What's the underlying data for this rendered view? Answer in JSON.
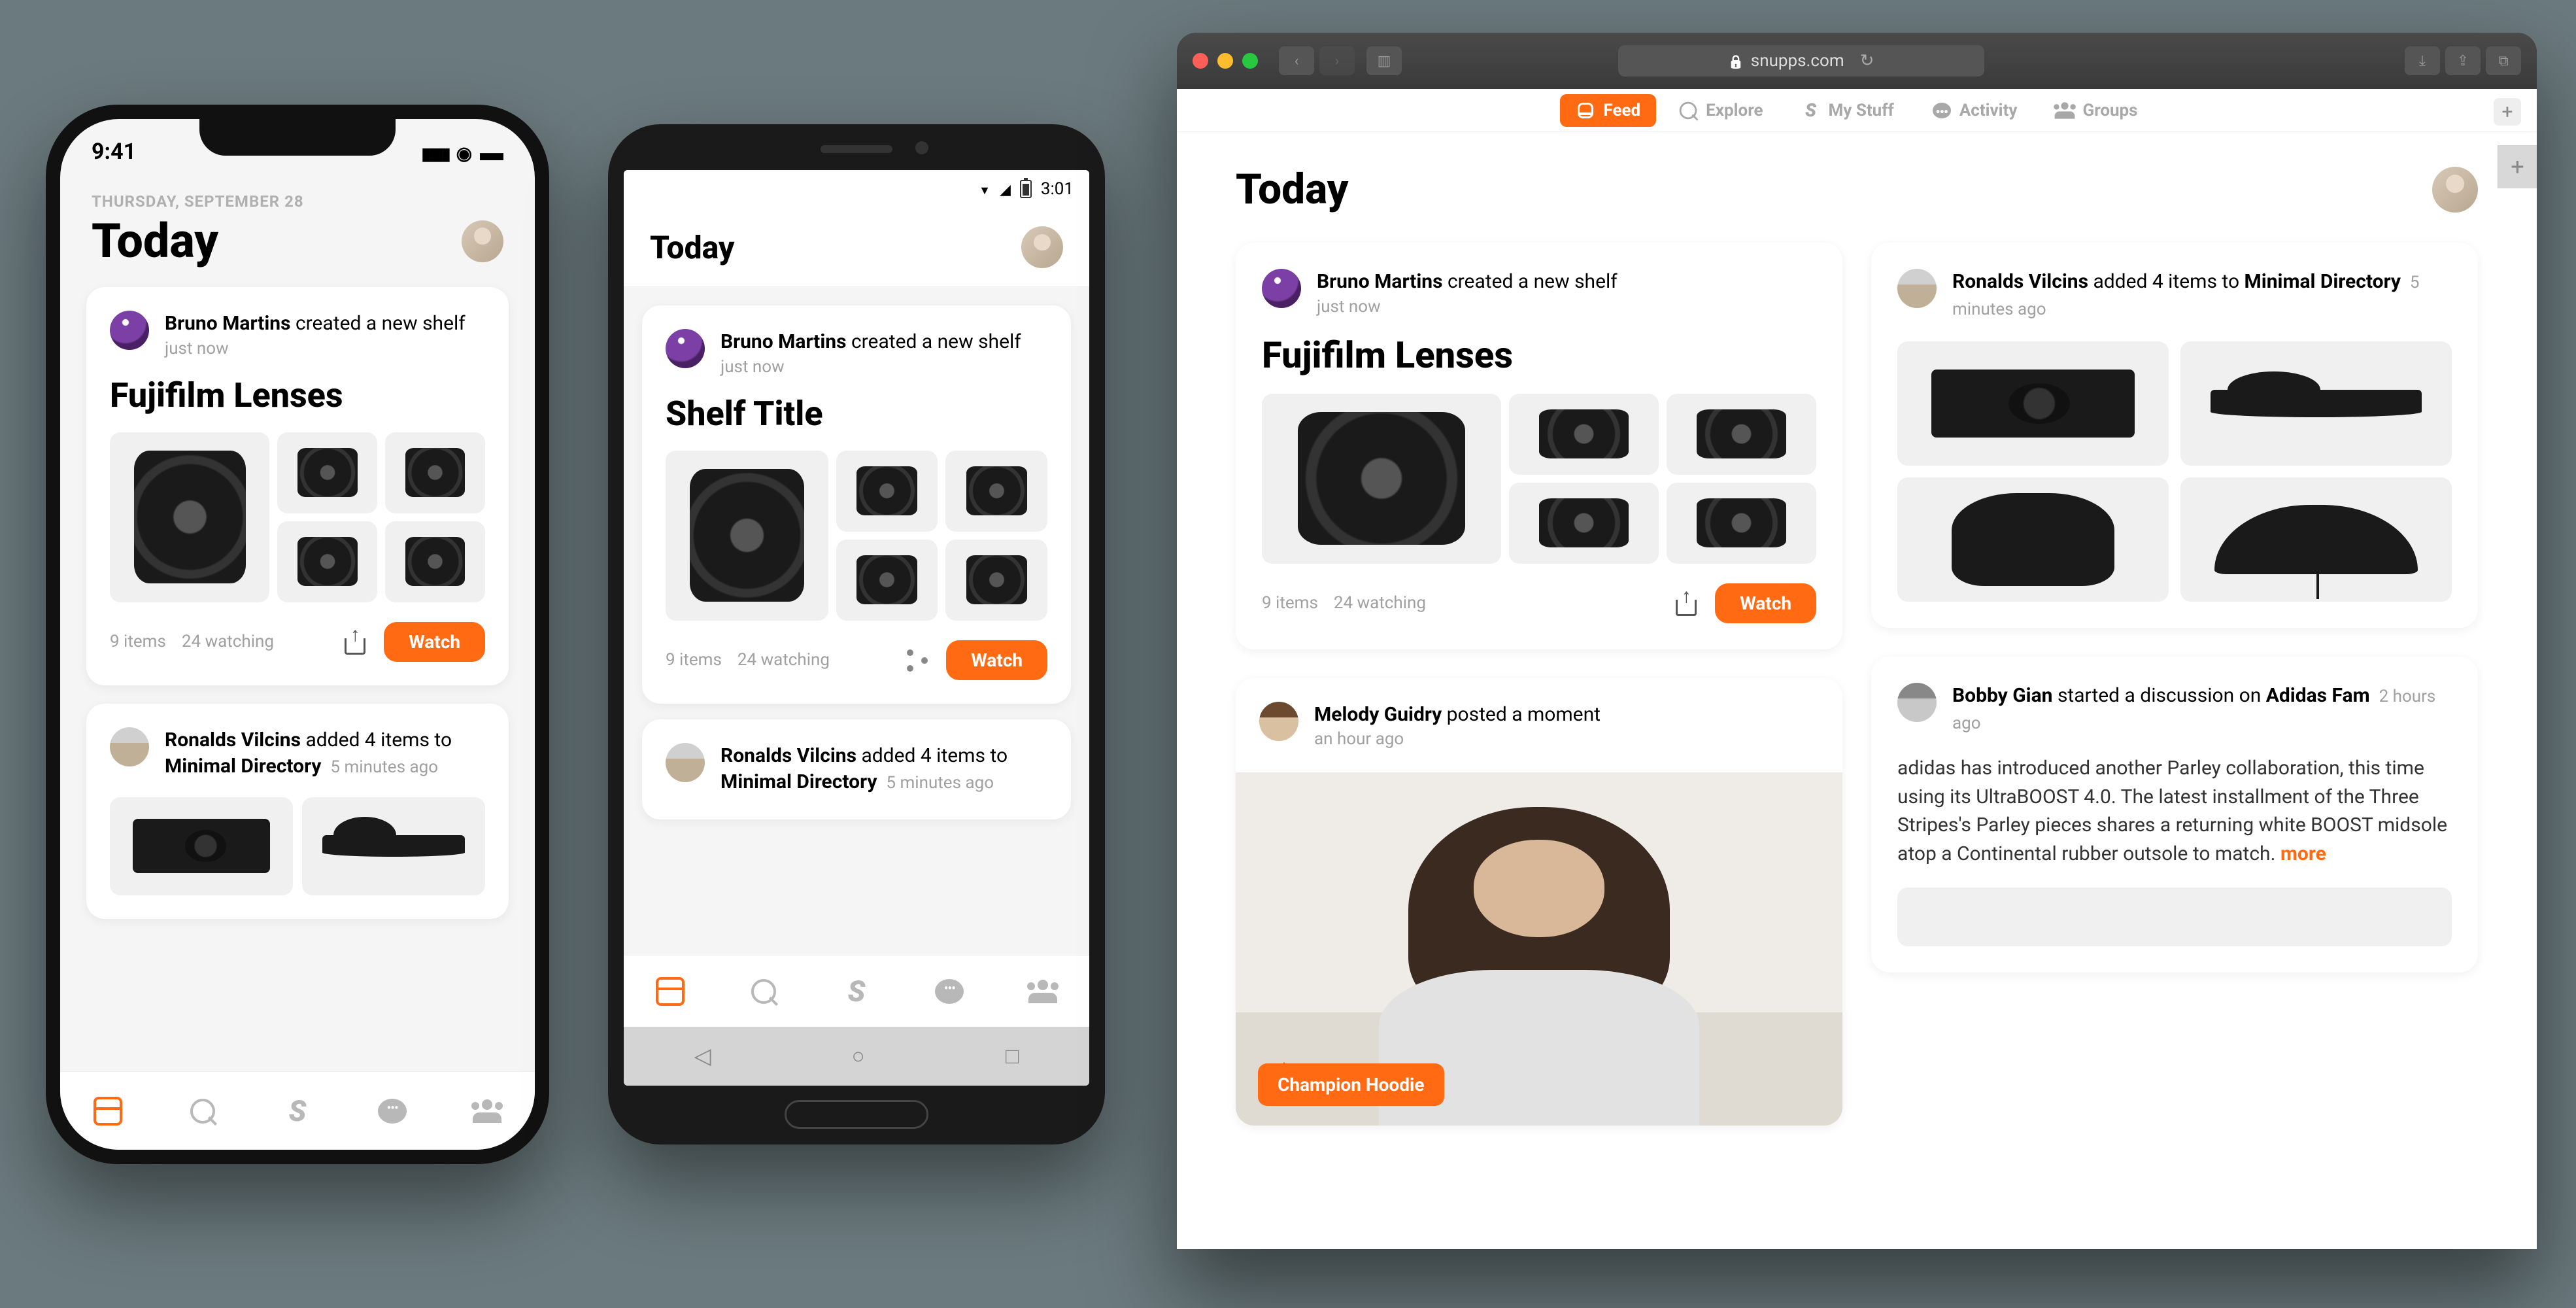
{
  "colors": {
    "accent": "#ff6a13"
  },
  "iphone": {
    "status_time": "9:41",
    "date": "THURSDAY, SEPTEMBER 28",
    "title": "Today",
    "card1": {
      "author": "Bruno Martins",
      "action": " created a new shelf",
      "time": "just now",
      "shelf_title": "Fujifilm Lenses",
      "items_count": "9 items",
      "watching": "24 watching",
      "watch_label": "Watch"
    },
    "card2": {
      "author": "Ronalds Vilcins",
      "action": " added 4 items to ",
      "link": "Minimal Directory",
      "time": "5 minutes ago"
    }
  },
  "android": {
    "status_time": "3:01",
    "title": "Today",
    "card1": {
      "author": "Bruno Martins",
      "action": " created a new shelf",
      "time": "just now",
      "shelf_title": "Shelf Title",
      "items_count": "9 items",
      "watching": "24 watching",
      "watch_label": "Watch"
    },
    "card2": {
      "author": "Ronalds Vilcins",
      "action": " added 4 items to ",
      "link": "Minimal Directory",
      "time": "5 minutes ago"
    }
  },
  "web": {
    "url": "snupps.com",
    "nav": {
      "feed": "Feed",
      "explore": "Explore",
      "mystuff": "My Stuff",
      "activity": "Activity",
      "groups": "Groups"
    },
    "title": "Today",
    "card_shelf": {
      "author": "Bruno Martins",
      "action": " created a new shelf",
      "time": "just now",
      "shelf_title": "Fujifilm Lenses",
      "items_count": "9 items",
      "watching": "24 watching",
      "watch_label": "Watch"
    },
    "card_items": {
      "author": "Ronalds Vilcins",
      "action": " added 4 items to ",
      "link": "Minimal Directory",
      "time": "5 minutes ago"
    },
    "card_moment": {
      "author": "Melody Guidry",
      "action": " posted a moment",
      "time": "an hour ago",
      "tag": "Champion Hoodie"
    },
    "card_discussion": {
      "author": "Bobby Gian",
      "action": " started a discussion on ",
      "link": "Adidas Fam",
      "time": "2 hours ago",
      "body": "adidas has introduced another Parley collaboration, this time using its UltraBOOST 4.0. The latest installment of the Three Stripes's Parley pieces shares a returning white BOOST midsole atop a Continental rubber outsole to match.",
      "more": "more"
    }
  }
}
